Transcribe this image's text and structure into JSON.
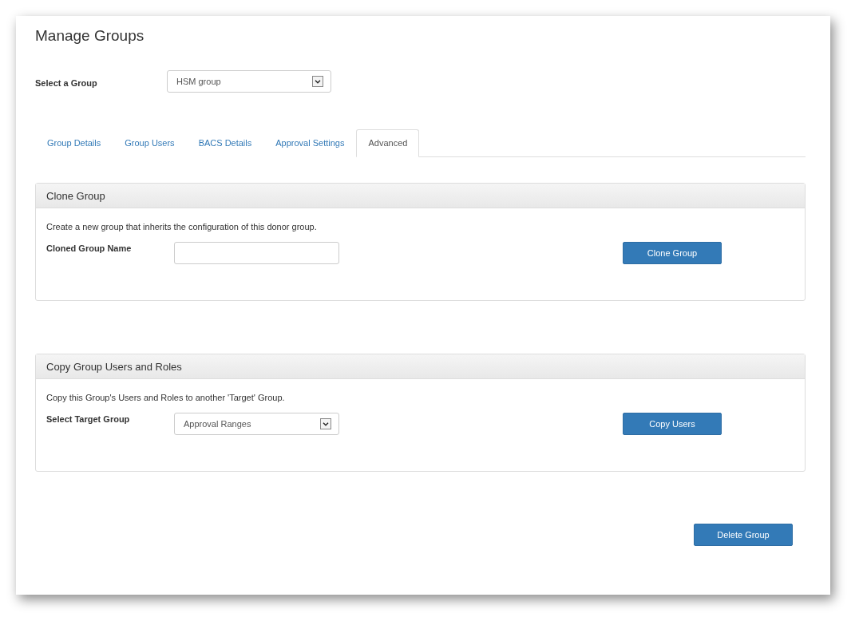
{
  "page": {
    "title": "Manage Groups"
  },
  "group_select": {
    "label": "Select a Group",
    "value": "HSM group"
  },
  "tabs": [
    {
      "label": "Group Details",
      "selected": false
    },
    {
      "label": "Group Users",
      "selected": false
    },
    {
      "label": "BACS Details",
      "selected": false
    },
    {
      "label": "Approval Settings",
      "selected": false
    },
    {
      "label": "Advanced",
      "selected": true
    }
  ],
  "panels": [
    {
      "title": "Clone Group",
      "description": "Create a new group that inherits the configuration of this donor group.",
      "field": {
        "kind": "text",
        "label": "Cloned Group Name"
      },
      "button": "Clone Group"
    },
    {
      "title": "Copy Group Users and Roles",
      "description": "Copy this Group's Users and Roles to another 'Target' Group.",
      "field": {
        "kind": "select",
        "label": "Select Target Group",
        "value": "Approval Ranges"
      },
      "button": "Copy Users"
    }
  ],
  "delete_button": "Delete Group"
}
